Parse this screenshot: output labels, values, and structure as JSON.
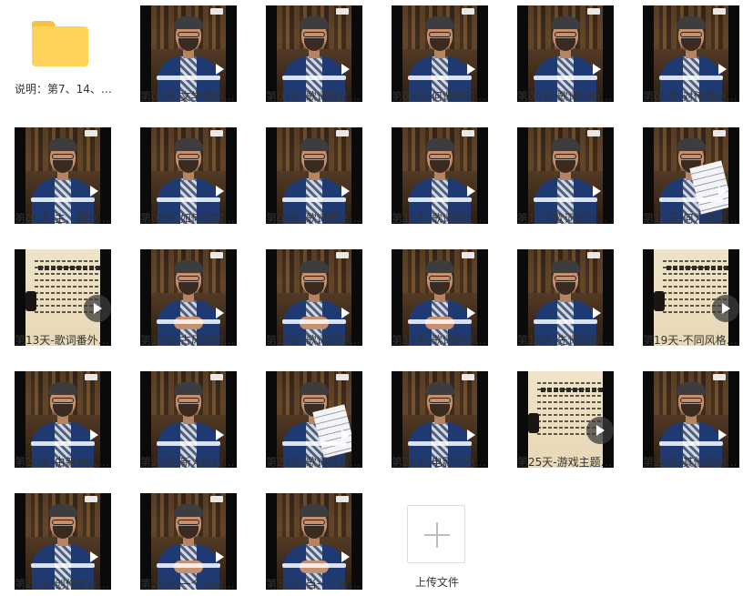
{
  "folder": {
    "label": "说明：第7、14、…",
    "icon": "folder-icon"
  },
  "files": [
    {
      "label": "第01天-文学载体…",
      "thumb": "person"
    },
    {
      "label": "第02天-歌词是社…",
      "thumb": "person"
    },
    {
      "label": "第03天-何谓中国…",
      "thumb": "person"
    },
    {
      "label": "第04天-歌词与新…",
      "thumb": "person"
    },
    {
      "label": "第05条-对传统诗…",
      "thumb": "person"
    },
    {
      "label": "第06天-主、副歌…",
      "thumb": "person"
    },
    {
      "label": "第08条-如何欣赏…",
      "thumb": "person"
    },
    {
      "label": "第09天-歌词灵感…",
      "thumb": "person"
    },
    {
      "label": "第10天-歌词词汇…",
      "thumb": "person"
    },
    {
      "label": "第11天歌词画面…",
      "thumb": "person"
    },
    {
      "label": "第12天-何为原创…",
      "thumb": "person-holding"
    },
    {
      "label": "第13天-歌词番外…",
      "thumb": "paper"
    },
    {
      "label": "第15天-古风歌词…",
      "thumb": "person-hands"
    },
    {
      "label": "第16天-歌词创作…",
      "thumb": "person-hands"
    },
    {
      "label": "第17天-歌词创作…",
      "thumb": "person-hands"
    },
    {
      "label": "第18天-先词后曲…",
      "thumb": "person"
    },
    {
      "label": "第19天-不同风格…",
      "thumb": "paper"
    },
    {
      "label": "第20天-由新诗入…",
      "thumb": "person"
    },
    {
      "label": "第22天-新人阶段…",
      "thumb": "person"
    },
    {
      "label": "第23天-歌词段落…",
      "thumb": "person-holding"
    },
    {
      "label": "第24天-电影与电…",
      "thumb": "person"
    },
    {
      "label": "第25天-游戏主题…",
      "thumb": "paper"
    },
    {
      "label": "第26天-其他活动…",
      "thumb": "person"
    },
    {
      "label": "第27天-创作生涯…",
      "thumb": "person"
    },
    {
      "label": "第29天-一个人资…",
      "thumb": "person-hands"
    },
    {
      "label": "第30天-当一个有…",
      "thumb": "person-hands"
    }
  ],
  "upload": {
    "label": "上传文件",
    "icon": "plus-icon"
  }
}
